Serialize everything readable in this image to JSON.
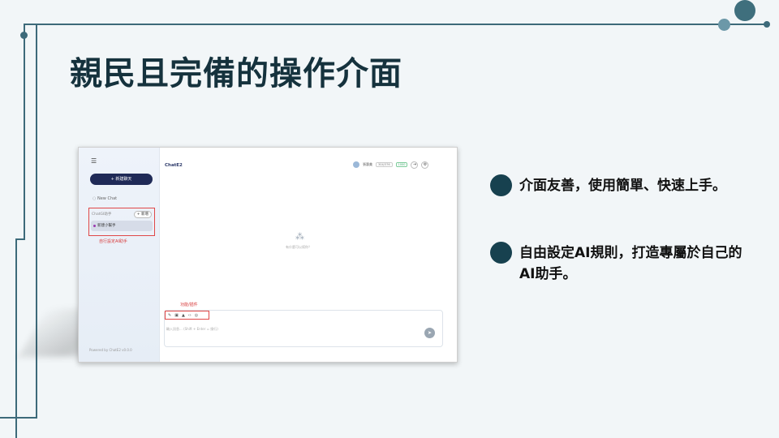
{
  "slide": {
    "title": "親民且完備的操作介面",
    "bullets": [
      "介面友善，使用簡單、快速上手。",
      "自由設定AI規則，打造專屬於自己的AI助手。"
    ]
  },
  "screenshot": {
    "sidebar": {
      "menu_icon": "menu-icon",
      "new_chat_button": "+ 新建聊天",
      "new_chat_item": "New Chat",
      "assistant_section_label": "ChatGI助手",
      "add_button": "+ 新增",
      "assistant_item": "新建小幫手",
      "note": "自行設定AI助手",
      "powered_by": "Powered by ChatE2 v0.0.0"
    },
    "header": {
      "app_title": "ChatE2",
      "user_name": "張惠美",
      "chip_1": "304/376",
      "chip_2": "1000"
    },
    "center": {
      "text": "有什麼可以幫你？"
    },
    "input": {
      "tools_note": "功能/插件",
      "placeholder": "輸入訊息... (Shift + Enter = 換行)"
    }
  },
  "colors": {
    "title": "#15323d",
    "bullet_dot": "#17414f",
    "deco_line": "#3d6a7a",
    "annotation_red": "#e04848"
  }
}
